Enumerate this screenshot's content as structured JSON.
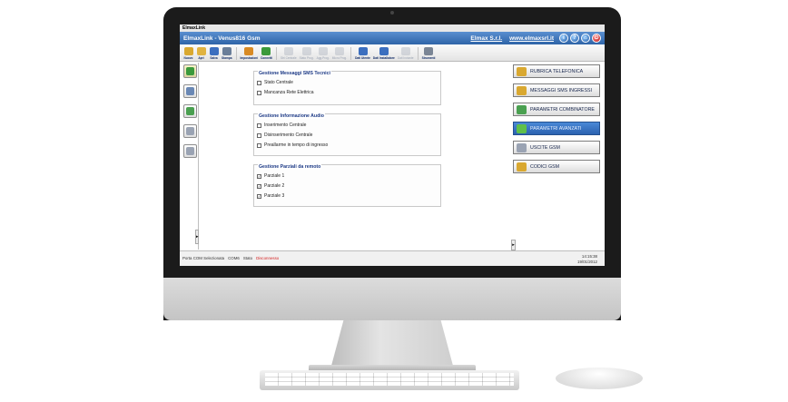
{
  "os_titlebar": {
    "title": "ElmaxLink"
  },
  "header": {
    "title": "ElmaxLink - Venus816 Gsm",
    "company": "Elmax S.r.l.",
    "website": "www.elmaxsrl.it",
    "icons": [
      "info-icon",
      "help-icon",
      "home-icon",
      "exit-icon"
    ]
  },
  "toolbar": {
    "items": [
      {
        "label": "Nuovo",
        "icon": "new-file-icon",
        "color": "#d9a830",
        "enabled": true
      },
      {
        "label": "Apri",
        "icon": "open-folder-icon",
        "color": "#e0b341",
        "enabled": true
      },
      {
        "label": "Salva",
        "icon": "save-icon",
        "color": "#3c6fbf",
        "enabled": true
      },
      {
        "label": "Stampa",
        "icon": "print-icon",
        "color": "#6a7e99",
        "enabled": true
      },
      {
        "label": "Impostazioni",
        "icon": "settings-icon",
        "color": "#d88a24",
        "enabled": true
      },
      {
        "label": "Connetti",
        "icon": "connect-icon",
        "color": "#3b9a3b",
        "enabled": true
      },
      {
        "label": "Stri Centrale",
        "icon": "stri-centrale-icon",
        "color": "#9aa3b3",
        "enabled": false
      },
      {
        "label": "Stato Prog.",
        "icon": "stato-prog-icon",
        "color": "#9aa3b3",
        "enabled": false
      },
      {
        "label": "Agg.Prog.",
        "icon": "agg-prog-icon",
        "color": "#9aa3b3",
        "enabled": false
      },
      {
        "label": "Micro Prog.",
        "icon": "micro-prog-icon",
        "color": "#9aa3b3",
        "enabled": false
      },
      {
        "label": "Dati Utente",
        "icon": "user-data-icon",
        "color": "#3c6fbf",
        "enabled": true
      },
      {
        "label": "Dati Installatore",
        "icon": "installer-data-icon",
        "color": "#3c6fbf",
        "enabled": true
      },
      {
        "label": "Dati Inviante",
        "icon": "sender-data-icon",
        "color": "#9aa3b3",
        "enabled": false
      },
      {
        "label": "Strumenti",
        "icon": "tools-icon",
        "color": "#7a8595",
        "enabled": true
      }
    ]
  },
  "left_sidebar": {
    "items": [
      {
        "icon": "modules-icon",
        "color": "#3b9a3b",
        "active": true
      },
      {
        "icon": "document-icon",
        "color": "#6a88b5",
        "active": false
      },
      {
        "icon": "image-icon",
        "color": "#4aa050",
        "active": false
      },
      {
        "icon": "clipboard-icon",
        "color": "#9aa3b3",
        "active": false
      },
      {
        "icon": "key-icon",
        "color": "#9aa3b3",
        "active": false
      }
    ],
    "scroll_arrow": "▸"
  },
  "groups": [
    {
      "title": "Gestione Messaggi SMS Tecnici",
      "options": [
        {
          "label": "Stato Centrale",
          "checked": false
        },
        {
          "label": "Mancanza Rete Elettrica",
          "checked": false
        }
      ]
    },
    {
      "title": "Gestione Informazione Audio",
      "options": [
        {
          "label": "Inserimento Centrale",
          "checked": false
        },
        {
          "label": "Disinserimento Centrale",
          "checked": false
        },
        {
          "label": "Preallarme in tempo di ingresso",
          "checked": false
        }
      ]
    },
    {
      "title": "Gestione Parziali da remoto",
      "options": [
        {
          "label": "Parziale 1",
          "checked": true
        },
        {
          "label": "Parziale 2",
          "checked": true
        },
        {
          "label": "Parziale 3",
          "checked": true
        }
      ]
    }
  ],
  "mid_scroll_arrow": "▸",
  "right_panel": {
    "buttons": [
      {
        "label": "RUBRICA TELEFONICA",
        "icon": "phonebook-icon",
        "color": "#d9a830",
        "active": false
      },
      {
        "label": "MESSAGGI SMS INGRESSI",
        "icon": "sms-icon",
        "color": "#d9a830",
        "active": false
      },
      {
        "label": "PARAMETRI COMBINATORE",
        "icon": "dialer-icon",
        "color": "#4aa050",
        "active": false
      },
      {
        "label": "PARAMETRI AVANZATI",
        "icon": "advanced-params-icon",
        "color": "#5fbf4a",
        "active": true
      },
      {
        "label": "USCITE GSM",
        "icon": "gsm-output-icon",
        "color": "#9aa3b3",
        "active": false
      },
      {
        "label": "CODICI GSM",
        "icon": "gsm-codes-icon",
        "color": "#d9a830",
        "active": false
      }
    ]
  },
  "status": {
    "com_label": "Porta COM Selezionata",
    "com_value": "COM6",
    "stato_label": "Stato",
    "stato_value": "Disconnesso",
    "time": "14:15:38",
    "date": "19/01/2012"
  }
}
